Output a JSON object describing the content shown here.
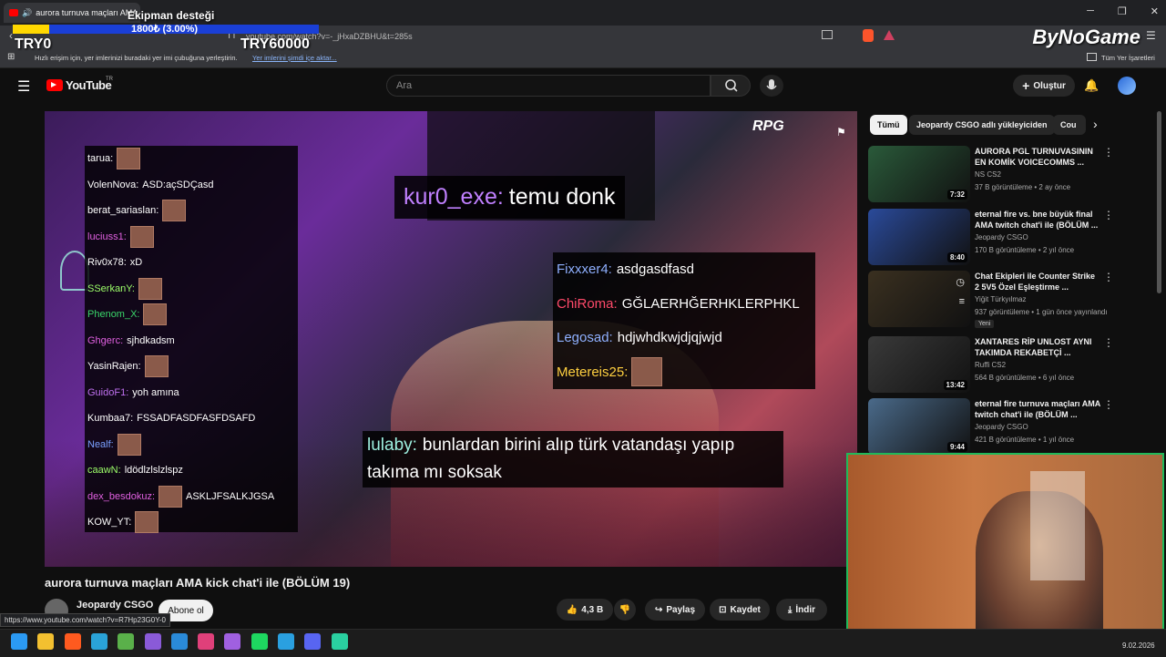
{
  "browser": {
    "tab_title": "aurora turnuva maçları AMA",
    "url": "youtube.com/watch?v=-_jHxaDZBHU&t=285s",
    "bookmarks_hint": "Hızlı erişim için, yer imlerinizi buradaki yer imi çubuğuna yerleştirin.",
    "bookmarks_link": "Yer imlerini şimdi içe aktar...",
    "all_bookmarks": "Tüm Yer İşaretleri",
    "win_minimize": "─",
    "win_restore": "❐",
    "win_close": "✕"
  },
  "overlay": {
    "donation_title": "Ekipman desteği",
    "donation_progress": "1800₺ (3.00%)",
    "donation_fraction": 0.03,
    "donation_current": "TRY0",
    "donation_goal": "TRY60000",
    "sponsor": "ByNoGame"
  },
  "youtube": {
    "logo": "YouTube",
    "country": "TR",
    "search_placeholder": "Ara",
    "create_label": "Oluştur"
  },
  "chat": [
    {
      "user": "tarua:",
      "msg": "",
      "emote": true,
      "color": "#ffffff"
    },
    {
      "user": "VolenNova:",
      "msg": "ASD:açSDÇasd",
      "emote": false,
      "color": "#ffffff"
    },
    {
      "user": "berat_sariaslan:",
      "msg": "",
      "emote": true,
      "color": "#ffffff"
    },
    {
      "user": "luciuss1:",
      "msg": "",
      "emote": true,
      "color": "#e060e0"
    },
    {
      "user": "Riv0x78:",
      "msg": "xD",
      "emote": false,
      "color": "#ffffff"
    },
    {
      "user": "SSerkanY:",
      "msg": "",
      "emote": true,
      "color": "#9dff6a"
    },
    {
      "user": "Phenom_X:",
      "msg": "",
      "emote": true,
      "color": "#3ad66a"
    },
    {
      "user": "Ghgerc:",
      "msg": "sjhdkadsm",
      "emote": false,
      "color": "#e060e0"
    },
    {
      "user": "YasinRajen:",
      "msg": "",
      "emote": true,
      "color": "#ffffff"
    },
    {
      "user": "GuidoF1:",
      "msg": "yoh amına",
      "emote": false,
      "color": "#c070f0"
    },
    {
      "user": "Kumbaa7:",
      "msg": "FSSADFASDFASFDSAFD",
      "emote": false,
      "color": "#ffffff"
    },
    {
      "user": "Nealf:",
      "msg": "",
      "emote": true,
      "color": "#7aa0ff"
    },
    {
      "user": "caawN:",
      "msg": "ldödlzlslzlspz",
      "emote": false,
      "color": "#9dff6a"
    },
    {
      "user": "dex_besdokuz:",
      "msg": "ASKLJFSALKJGSA",
      "emote": true,
      "color": "#e060e0"
    },
    {
      "user": "KOW_YT:",
      "msg": "",
      "emote": true,
      "color": "#ffffff"
    }
  ],
  "highlights": {
    "h1_user": "kur0_exe:",
    "h1_msg": "temu donk",
    "right_box": [
      {
        "user": "Fixxxer4:",
        "msg": "asdgasdfasd",
        "color": "#8fb0ff",
        "emote": false
      },
      {
        "user": "ChiRoma:",
        "msg": "GĞLAERHĞERHKLERPHKL",
        "color": "#ff4a6a",
        "emote": false
      },
      {
        "user": "Legosad:",
        "msg": "hdjwhdkwjdjqjwjd",
        "color": "#8fb0ff",
        "emote": false
      },
      {
        "user": "Metereis25:",
        "msg": "",
        "color": "#ffd040",
        "emote": true
      }
    ],
    "h2_user": "lulaby:",
    "h2_msg_line1": "bunlardan birini alıp türk vatandaşı yapıp",
    "h2_msg_line2": "takıma mı soksak"
  },
  "video_brand": "RPG",
  "video_info": {
    "title": "aurora turnuva maçları AMA kick chat'i ile (BÖLÜM 19)",
    "channel": "Jeopardy CSGO",
    "subscribe": "Abone ol",
    "likes": "4,3 B",
    "share": "Paylaş",
    "save": "Kaydet",
    "download": "İndir",
    "status_url": "https://www.youtube.com/watch?v=R7Hp23G0Y-0"
  },
  "chips": [
    "Tümü",
    "Jeopardy CSGO adlı yükleyiciden",
    "Cou"
  ],
  "recommendations": [
    {
      "title": "AURORA PGL TURNUVASININ EN KOMİK VOICECOMMS ...",
      "channel": "NS CS2",
      "meta": "37 B görüntüleme • 2 ay önce",
      "duration": "7:32",
      "badge": "",
      "thumb_color": "#2a5a3a"
    },
    {
      "title": "eternal fire vs. bne büyük final AMA twitch chat'i ile (BÖLÜM ...",
      "channel": "Jeopardy CSGO",
      "meta": "170 B görüntüleme • 2 yıl önce",
      "duration": "8:40",
      "badge": "",
      "thumb_color": "#2a4a9a"
    },
    {
      "title": "Chat Ekipleri ile Counter Strike 2 5V5 Özel Eşleştirme ...",
      "channel": "Yiğit Türkyılmaz",
      "meta": "937 görüntüleme • 1 gün önce yayınlandı",
      "duration": "",
      "badge": "Yeni",
      "thumb_color": "#3a3020"
    },
    {
      "title": "XANTARES RİP UNLOST AYNI TAKIMDA REKABETÇİ ...",
      "channel": "Ruffi CS2",
      "meta": "564 B görüntüleme • 6 yıl önce",
      "duration": "13:42",
      "badge": "",
      "thumb_color": "#3a3a3a"
    },
    {
      "title": "eternal fire turnuva maçları AMA twitch chat'i ile (BÖLÜM ...",
      "channel": "Jeopardy CSGO",
      "meta": "421 B görüntüleme • 1 yıl önce",
      "duration": "9:44",
      "badge": "",
      "thumb_color": "#4a6a8a"
    }
  ],
  "taskbar": {
    "date": "9.02.2026",
    "apps": [
      "windows-start",
      "file-explorer",
      "brave",
      "remote-desktop",
      "photos",
      "visual-studio",
      "vs-code",
      "instagram",
      "feather",
      "spotify",
      "telegram",
      "discord",
      "streamlabs"
    ],
    "app_colors": [
      "#2b9af3",
      "#f3c030",
      "#ff5a1f",
      "#2aa3d8",
      "#5ab04a",
      "#8a5ad8",
      "#2a8ad8",
      "#e0407a",
      "#a060e0",
      "#1ed760",
      "#2aa0e0",
      "#5865f2",
      "#2ad0a0"
    ]
  },
  "colors": {
    "accent": "#ff0000",
    "webcam_border": "#1fb95a"
  }
}
